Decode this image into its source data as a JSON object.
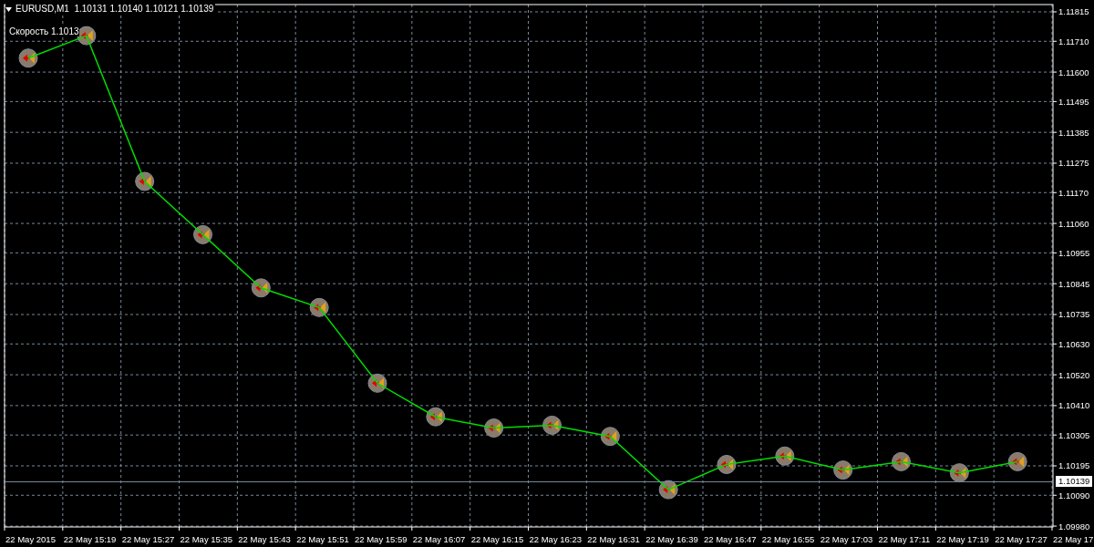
{
  "chart": {
    "title": "EURUSD,M1  1.10131 1.10140 1.10121 1.10139",
    "indicator_label": "Скорость 1.1013",
    "current_price": "1.10139",
    "chart_data": {
      "type": "line",
      "categories": [
        "22 May 2015",
        "22 May 15:19",
        "22 May 15:27",
        "22 May 15:35",
        "22 May 15:43",
        "22 May 15:51",
        "22 May 15:59",
        "22 May 16:07",
        "22 May 16:15",
        "22 May 16:23",
        "22 May 16:31",
        "22 May 16:39",
        "22 May 16:47",
        "22 May 16:55",
        "22 May 17:03",
        "22 May 17:11",
        "22 May 17:19",
        "22 May 17:27",
        "22 May 17"
      ],
      "values": [
        1.1165,
        1.1173,
        1.1121,
        1.1102,
        1.1083,
        1.1076,
        1.1049,
        1.1037,
        1.1033,
        1.1034,
        1.103,
        1.1011,
        1.102,
        1.1023,
        1.1018,
        1.1021,
        1.1017,
        1.1021,
        null
      ],
      "grid": true,
      "marker": "circle",
      "ylim": [
        1.09977,
        1.11841
      ],
      "yticks": [
        {
          "value": 1.11815,
          "label": "1.11815"
        },
        {
          "value": 1.1171,
          "label": "1.11710"
        },
        {
          "value": 1.116,
          "label": "1.11600"
        },
        {
          "value": 1.11495,
          "label": "1.11495"
        },
        {
          "value": 1.11385,
          "label": "1.11385"
        },
        {
          "value": 1.11275,
          "label": "1.11275"
        },
        {
          "value": 1.1117,
          "label": "1.11170"
        },
        {
          "value": 1.1106,
          "label": "1.11060"
        },
        {
          "value": 1.10955,
          "label": "1.10955"
        },
        {
          "value": 1.10845,
          "label": "1.10845"
        },
        {
          "value": 1.10735,
          "label": "1.10735"
        },
        {
          "value": 1.1063,
          "label": "1.10630"
        },
        {
          "value": 1.1052,
          "label": "1.10520"
        },
        {
          "value": 1.1041,
          "label": "1.10410"
        },
        {
          "value": 1.10305,
          "label": "1.10305"
        },
        {
          "value": 1.10195,
          "label": "1.10195"
        },
        {
          "value": 1.1009,
          "label": "1.10090"
        },
        {
          "value": 1.0998,
          "label": "1.09980"
        }
      ]
    }
  }
}
